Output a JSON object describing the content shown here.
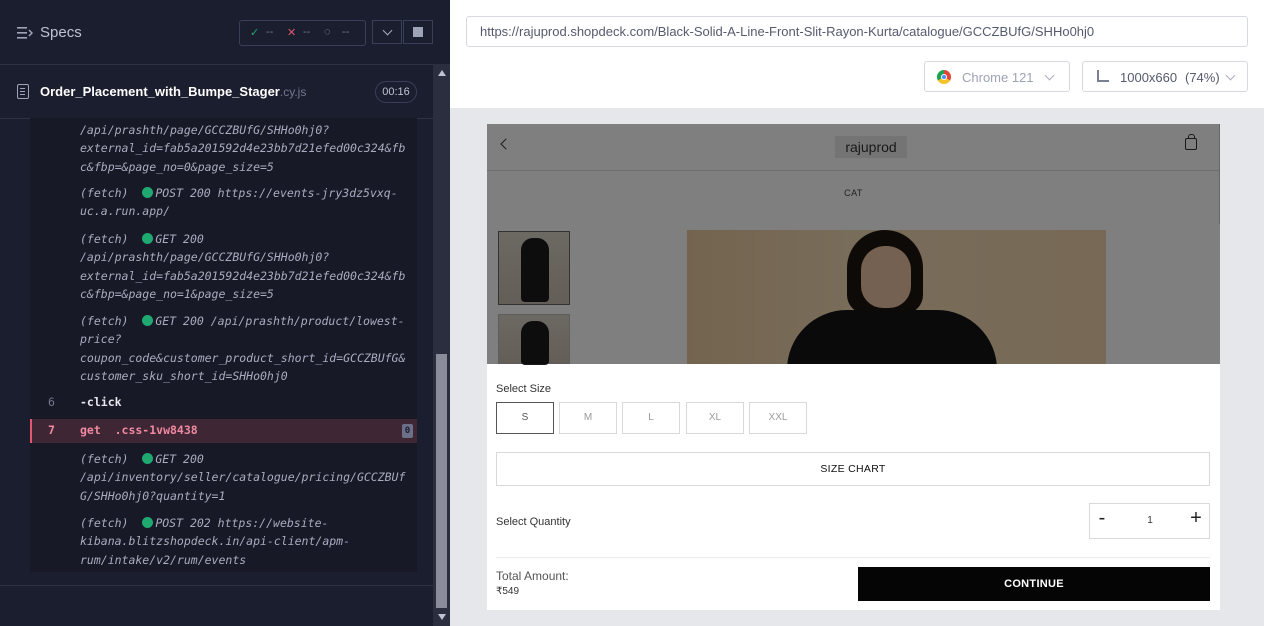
{
  "runner": {
    "specs_label": "Specs",
    "stats": {
      "pass_icon": "✓",
      "pass_count": "--",
      "fail_icon": "✕",
      "fail_count": "--",
      "pending_icon": "◌",
      "pending_count": "--"
    },
    "spec_name": "Order_Placement_with_Bumpe_Stager",
    "spec_ext": ".cy.js",
    "timer": "00:16",
    "log": [
      {
        "kind": "fetch-cont",
        "line1": "/api/prashth/page/GCCZBUfG/SHHo0hj0?",
        "line2": "external_id=fab5a201592d4e23bb7d21efed00c324&fb",
        "line3": "c&fbp=&page_no=0&page_size=5"
      },
      {
        "kind": "fetch",
        "prefix": "(fetch)",
        "line1": "POST 200 https://events-jry3dz5vxq-",
        "line2": "uc.a.run.app/"
      },
      {
        "kind": "fetch",
        "prefix": "(fetch)",
        "line1": "GET 200",
        "line2": "/api/prashth/page/GCCZBUfG/SHHo0hj0?",
        "line3": "external_id=fab5a201592d4e23bb7d21efed00c324&fb",
        "line4": "c&fbp=&page_no=1&page_size=5"
      },
      {
        "kind": "fetch",
        "prefix": "(fetch)",
        "line1": "GET 200 /api/prashth/product/lowest-",
        "line2": "price?",
        "line3": "coupon_code&customer_product_short_id=GCCZBUfG&",
        "line4": "customer_sku_short_id=SHHo0hj0"
      },
      {
        "kind": "step",
        "num": "6",
        "cmd": "-click"
      },
      {
        "kind": "active",
        "num": "7",
        "cmd": "get  .css-1vw8438",
        "badge": "0"
      },
      {
        "kind": "fetch",
        "prefix": "(fetch)",
        "line1": "GET 200",
        "line2": "/api/inventory/seller/catalogue/pricing/GCCZBUf",
        "line3": "G/SHHo0hj0?quantity=1"
      },
      {
        "kind": "fetch",
        "prefix": "(fetch)",
        "line1": "POST 202 https://website-",
        "line2": "kibana.blitzshopdeck.in/api-client/apm-",
        "line3": "rum/intake/v2/rum/events"
      }
    ]
  },
  "browser": {
    "url": "https://rajuprod.shopdeck.com/Black-Solid-A-Line-Front-Slit-Rayon-Kurta/catalogue/GCCZBUfG/SHHo0hj0",
    "browser_name": "Chrome 121",
    "viewport": "1000x660",
    "zoom": "(74%)"
  },
  "page": {
    "brand": "rajuprod",
    "category": "CAT",
    "select_size_label": "Select Size",
    "sizes": [
      "S",
      "M",
      "L",
      "XL",
      "XXL"
    ],
    "selected_size": "S",
    "size_chart_label": "SIZE CHART",
    "select_quantity_label": "Select Quantity",
    "qty_minus": "-",
    "quantity": "1",
    "qty_plus": "+",
    "total_label": "Total Amount:",
    "total_value": "₹549",
    "continue_label": "CONTINUE"
  }
}
